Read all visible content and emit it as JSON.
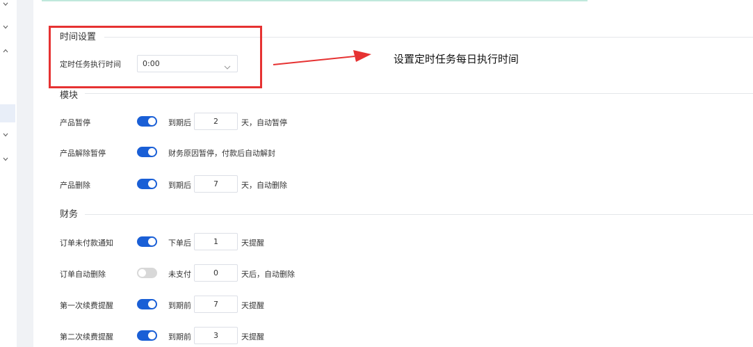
{
  "time_section": {
    "title": "时间设置",
    "cron_label": "定时任务执行时间",
    "cron_value": "0:00"
  },
  "annotation": "设置定时任务每日执行时间",
  "module_section": {
    "title": "模块",
    "rows": [
      {
        "label": "产品暂停",
        "enabled": true,
        "pre": "到期后",
        "value": "2",
        "post": "天，自动暂停"
      },
      {
        "label": "产品解除暂停",
        "enabled": true,
        "text": "财务原因暂停，付款后自动解封"
      },
      {
        "label": "产品删除",
        "enabled": true,
        "pre": "到期后",
        "value": "7",
        "post": "天，自动删除"
      }
    ]
  },
  "finance_section": {
    "title": "财务",
    "rows": [
      {
        "label": "订单未付款通知",
        "enabled": true,
        "pre": "下单后",
        "value": "1",
        "post": "天提醒"
      },
      {
        "label": "订单自动删除",
        "enabled": false,
        "pre": "未支付",
        "value": "0",
        "post": "天后，自动删除"
      },
      {
        "label": "第一次续费提醒",
        "enabled": true,
        "pre": "到期前",
        "value": "7",
        "post": "天提醒"
      },
      {
        "label": "第二次续费提醒",
        "enabled": true,
        "pre": "到期前",
        "value": "3",
        "post": "天提醒"
      }
    ]
  },
  "colors": {
    "toggle_on": "#1a5fd6",
    "toggle_off": "#d8d8d8",
    "highlight": "#e63232",
    "arrow": "#e63232"
  }
}
